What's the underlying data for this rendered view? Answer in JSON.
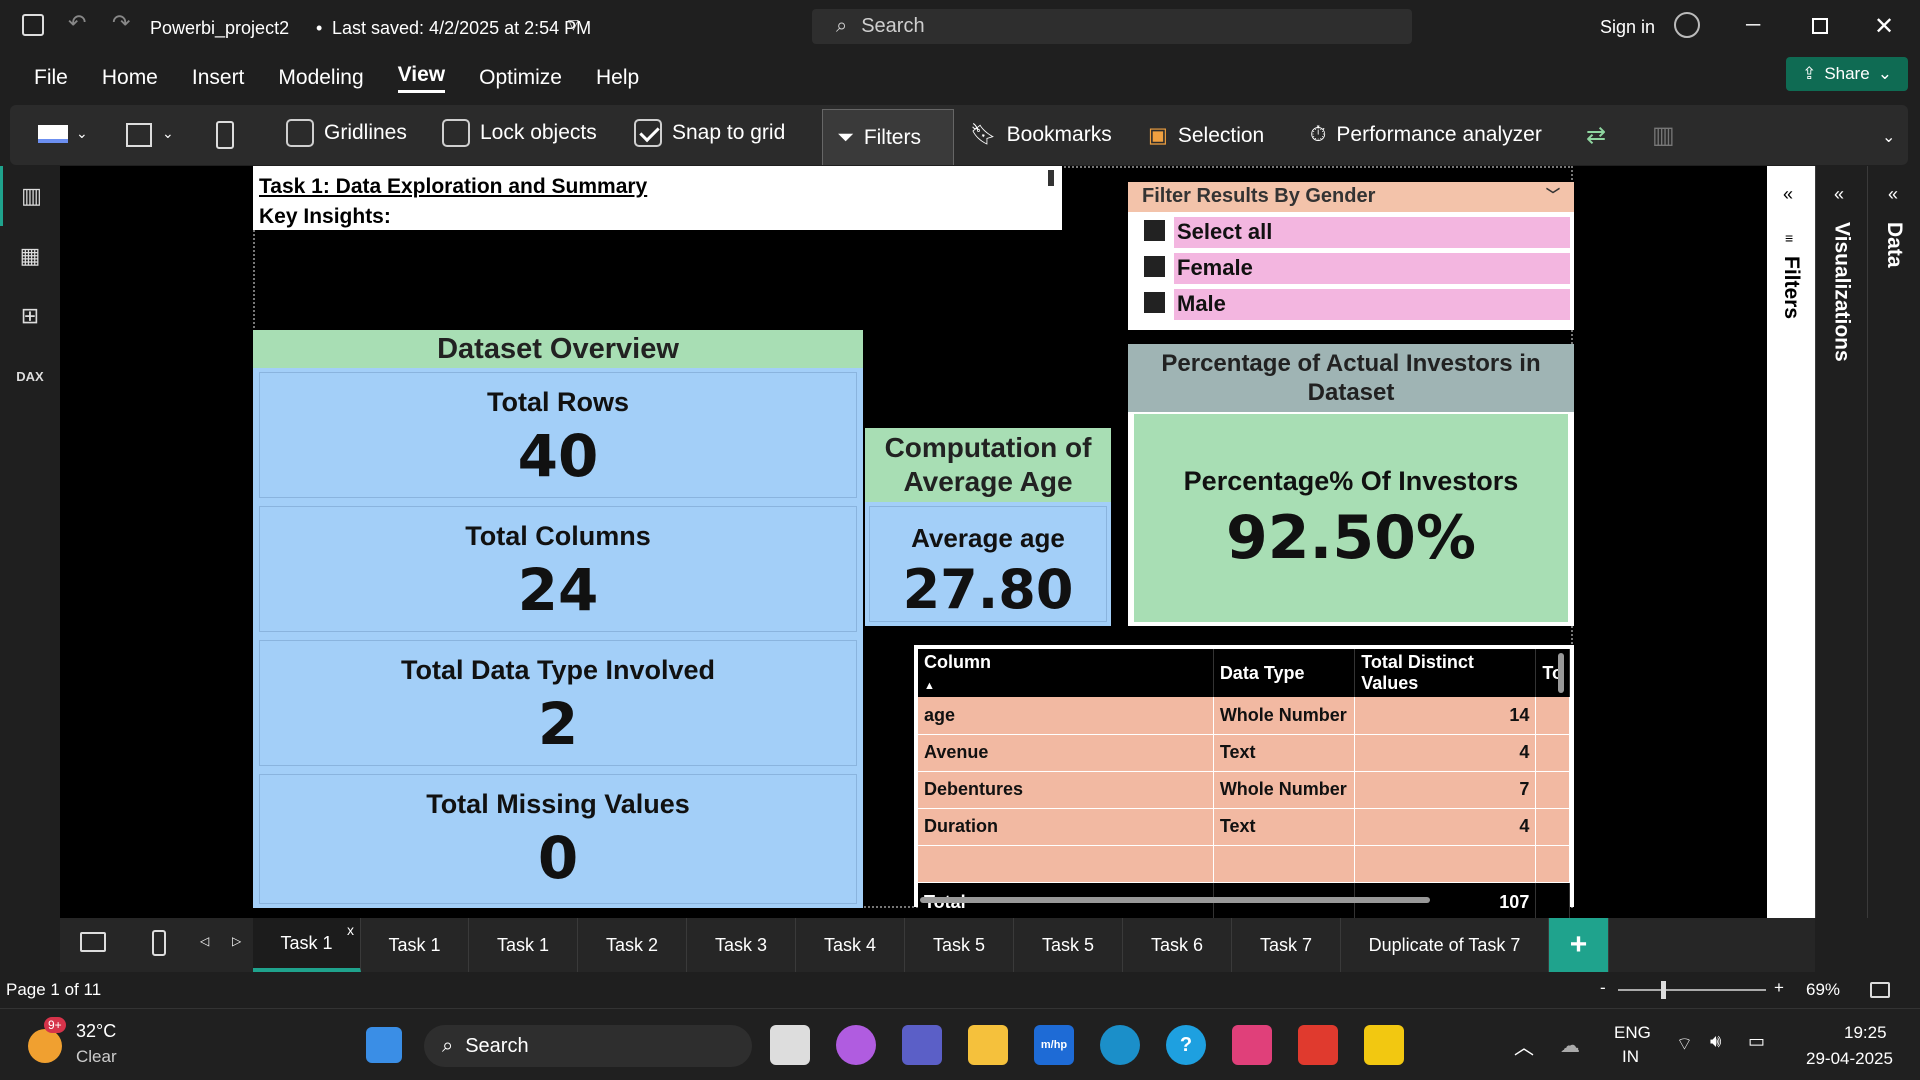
{
  "titlebar": {
    "file": "Powerbi_project2",
    "saved": "Last saved: 4/2/2025 at 2:54 PM",
    "search_placeholder": "Search",
    "sign_in": "Sign in"
  },
  "menu": [
    "File",
    "Home",
    "Insert",
    "Modeling",
    "View",
    "Optimize",
    "Help"
  ],
  "active_menu": "View",
  "share": "Share",
  "ribbon": {
    "gridlines": "Gridlines",
    "lock": "Lock objects",
    "snap": "Snap to grid",
    "filters": "Filters",
    "bookmarks": "Bookmarks",
    "selection": "Selection",
    "perf": "Performance analyzer"
  },
  "report": {
    "title": "Task 1: Data Exploration and Summary",
    "subtitle": "Key Insights:",
    "overview_head": "Dataset Overview",
    "cards": [
      {
        "label": "Total Rows",
        "value": "40"
      },
      {
        "label": "Total Columns",
        "value": "24"
      },
      {
        "label": "Total Data Type Involved",
        "value": "2"
      },
      {
        "label": "Total Missing Values",
        "value": "0"
      }
    ],
    "avg_head": "Computation of Average Age",
    "avg_label": "Average age",
    "avg_value": "27.80",
    "filter_head": "Filter Results By Gender",
    "filter_items": [
      "Select all",
      "Female",
      "Male"
    ],
    "inv_head": "Percentage of Actual Investors in Dataset",
    "inv_label": "Percentage% Of Investors",
    "inv_value": "92.50%",
    "table": {
      "headers": [
        "Column",
        "Data Type",
        "Total Distinct Values",
        "To"
      ],
      "rows": [
        [
          "age",
          "Whole Number",
          "14"
        ],
        [
          "Avenue",
          "Text",
          "4"
        ],
        [
          "Debentures",
          "Whole Number",
          "7"
        ],
        [
          "Duration",
          "Text",
          "4"
        ]
      ],
      "total_label": "Total",
      "total_value": "107"
    }
  },
  "panes": {
    "filters": "Filters",
    "visualizations": "Visualizations",
    "data": "Data"
  },
  "tabs": [
    "Task 1",
    "Task 1",
    "Task 1",
    "Task 2",
    "Task 3",
    "Task 4",
    "Task 5",
    "Task 5",
    "Task 6",
    "Task 7",
    "Duplicate of Task 7"
  ],
  "status": {
    "page": "Page 1 of 11",
    "zoom": "69%"
  },
  "taskbar": {
    "temp": "32°C",
    "weather": "Clear",
    "badge": "9+",
    "search": "Search",
    "lang1": "ENG",
    "lang2": "IN",
    "time": "19:25",
    "date": "29-04-2025"
  }
}
